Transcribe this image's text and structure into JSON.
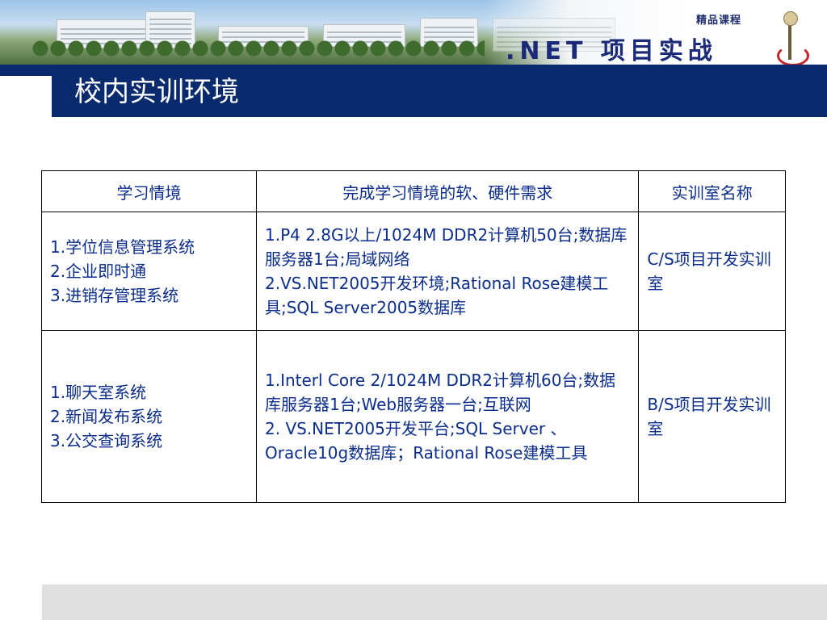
{
  "header": {
    "course_tag": "精品课程",
    "course_name": ".NET 项目实战"
  },
  "page": {
    "title": "校内实训环境"
  },
  "table": {
    "headers": [
      "学习情境",
      "完成学习情境的软、硬件需求",
      "实训室名称"
    ],
    "rows": [
      {
        "scenarios": [
          "1.学位信息管理系统",
          "2.企业即时通",
          "3.进销存管理系统"
        ],
        "requirements": [
          "1.P4 2.8G以上/1024M DDR2计算机50台;数据库服务器1台;局域网络",
          "2.VS.NET2005开发环境;Rational Rose建模工具;SQL Server2005数据库"
        ],
        "lab": "C/S项目开发实训室"
      },
      {
        "scenarios": [
          "1.聊天室系统",
          "2.新闻发布系统",
          "3.公交查询系统"
        ],
        "requirements": [
          "1.Interl Core 2/1024M DDR2计算机60台;数据库服务器1台;Web服务器一台;互联网",
          "2. VS.NET2005开发平台;SQL Server 、Oracle10g数据库；Rational Rose建模工具"
        ],
        "lab": "B/S项目开发实训室"
      }
    ]
  }
}
